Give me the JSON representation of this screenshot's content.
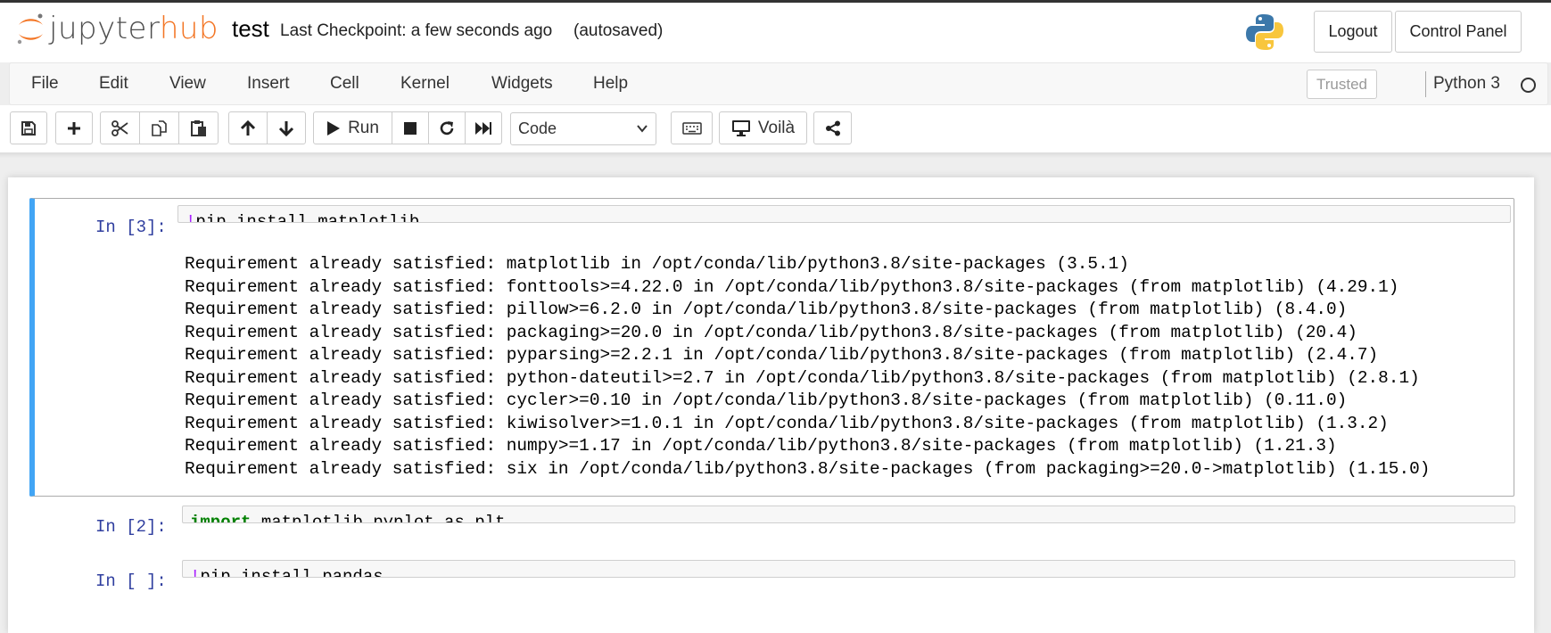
{
  "header": {
    "logo_text_1": "jupyter",
    "logo_text_2": "hub",
    "notebook_name": "test",
    "checkpoint": "Last Checkpoint: a few seconds ago",
    "autosave_status": "(autosaved)",
    "logout_label": "Logout",
    "control_panel_label": "Control Panel"
  },
  "menubar": {
    "items": [
      "File",
      "Edit",
      "View",
      "Insert",
      "Cell",
      "Kernel",
      "Widgets",
      "Help"
    ],
    "trusted_label": "Trusted",
    "kernel_name": "Python 3"
  },
  "toolbar": {
    "run_label": "Run",
    "cell_type": "Code",
    "voila_label": "Voilà",
    "icons": [
      "save-icon",
      "plus-icon",
      "cut-icon",
      "copy-icon",
      "paste-icon",
      "arrow-up-icon",
      "arrow-down-icon",
      "play-icon",
      "stop-icon",
      "restart-icon",
      "fast-forward-icon",
      "keyboard-icon",
      "desktop-icon",
      "share-icon"
    ]
  },
  "cells": [
    {
      "prompt": "In [3]:",
      "code_bang": "!",
      "code_rest": "pip install matplotlib",
      "output": [
        "Requirement already satisfied: matplotlib in /opt/conda/lib/python3.8/site-packages (3.5.1)",
        "Requirement already satisfied: fonttools>=4.22.0 in /opt/conda/lib/python3.8/site-packages (from matplotlib) (4.29.1)",
        "Requirement already satisfied: pillow>=6.2.0 in /opt/conda/lib/python3.8/site-packages (from matplotlib) (8.4.0)",
        "Requirement already satisfied: packaging>=20.0 in /opt/conda/lib/python3.8/site-packages (from matplotlib) (20.4)",
        "Requirement already satisfied: pyparsing>=2.2.1 in /opt/conda/lib/python3.8/site-packages (from matplotlib) (2.4.7)",
        "Requirement already satisfied: python-dateutil>=2.7 in /opt/conda/lib/python3.8/site-packages (from matplotlib) (2.8.1)",
        "Requirement already satisfied: cycler>=0.10 in /opt/conda/lib/python3.8/site-packages (from matplotlib) (0.11.0)",
        "Requirement already satisfied: kiwisolver>=1.0.1 in /opt/conda/lib/python3.8/site-packages (from matplotlib) (1.3.2)",
        "Requirement already satisfied: numpy>=1.17 in /opt/conda/lib/python3.8/site-packages (from matplotlib) (1.21.3)",
        "Requirement already satisfied: six in /opt/conda/lib/python3.8/site-packages (from packaging>=20.0->matplotlib) (1.15.0)"
      ]
    },
    {
      "prompt": "In [2]:",
      "code_kw": "import",
      "code_rest": " matplotlib.pyplot as plt"
    },
    {
      "prompt": "In [ ]:",
      "code_bang": "!",
      "code_rest": "pip install pandas"
    }
  ],
  "colors": {
    "brand_orange": "#f37524",
    "selected_cell_border": "#42a5f5",
    "prompt_blue": "#303f9f"
  }
}
